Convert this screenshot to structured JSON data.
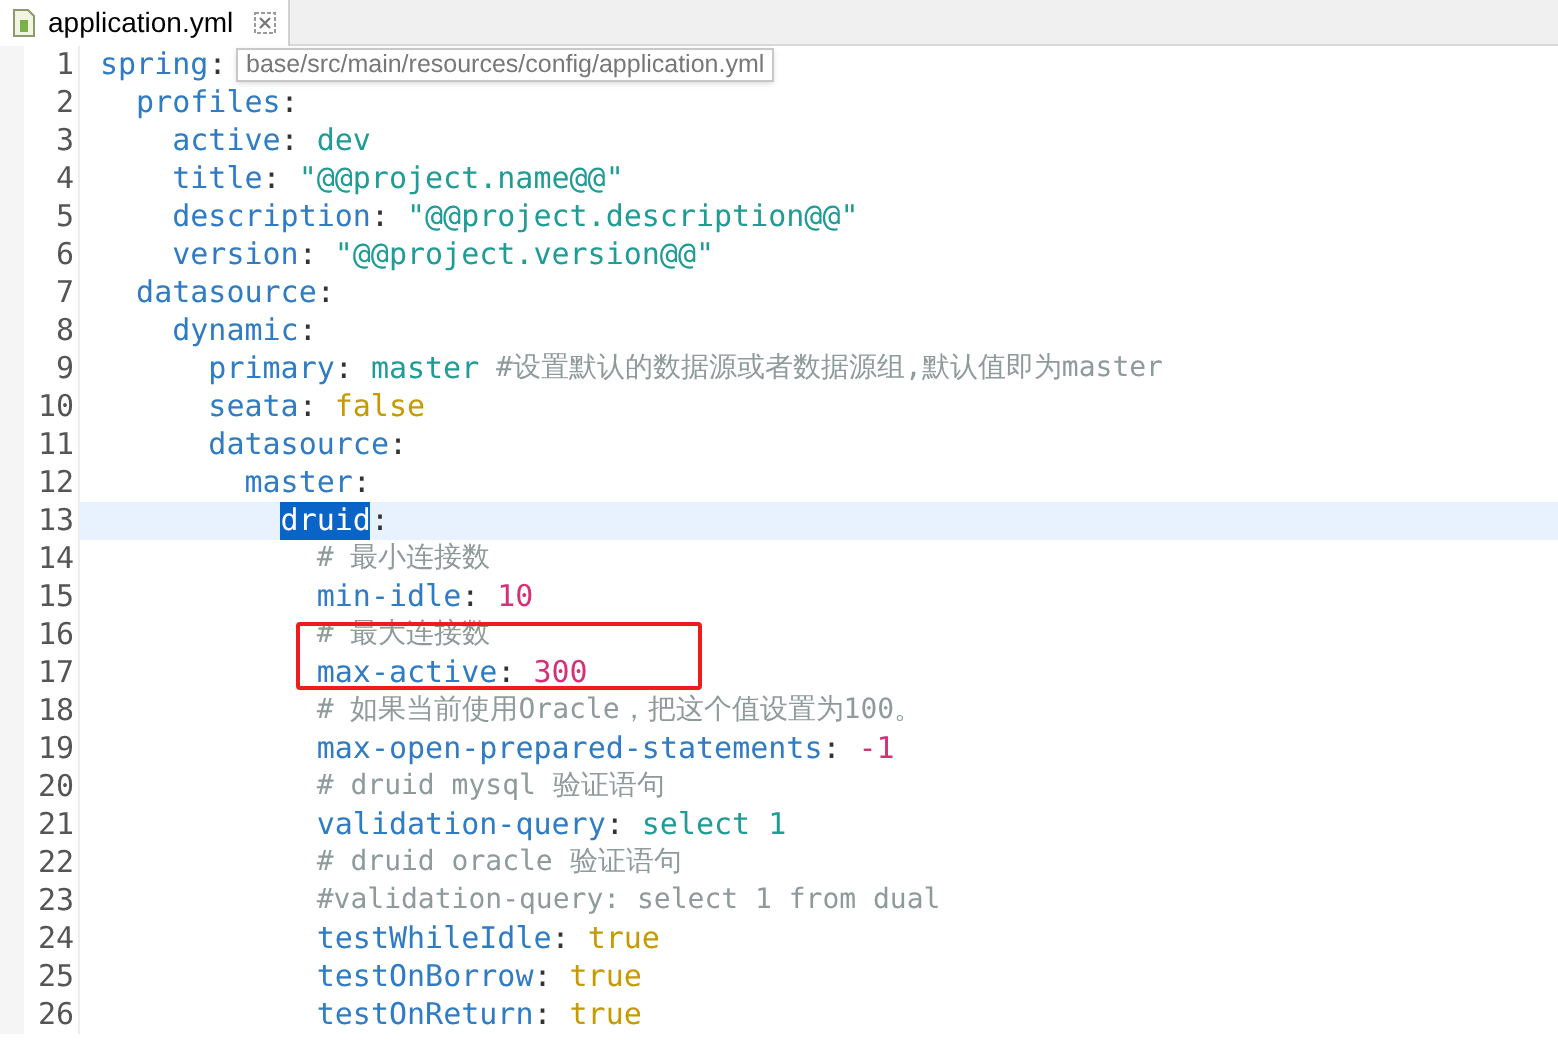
{
  "tab": {
    "label": "application.yml"
  },
  "tooltip": "base/src/main/resources/config/application.yml",
  "lines": [
    {
      "number": "1",
      "kind": "entry",
      "key": "spring",
      "separator": ":",
      "current": false,
      "boxed": false,
      "children": [
        {
          "number": "2",
          "kind": "entry",
          "key": "profiles",
          "separator": ":",
          "current": false,
          "boxed": false,
          "children": [
            {
              "number": "3",
              "kind": "entry",
              "key": "active",
              "separator": ":",
              "value": {
                "kind": "string",
                "text": "dev"
              },
              "current": false,
              "boxed": false
            },
            {
              "number": "4",
              "kind": "entry",
              "key": "title",
              "separator": ":",
              "value": {
                "kind": "string",
                "text": "\"@@project.name@@\""
              },
              "current": false,
              "boxed": false
            },
            {
              "number": "5",
              "kind": "entry",
              "key": "description",
              "separator": ":",
              "value": {
                "kind": "string",
                "text": "\"@@project.description@@\""
              },
              "current": false,
              "boxed": false
            },
            {
              "number": "6",
              "kind": "entry",
              "key": "version",
              "separator": ":",
              "value": {
                "kind": "string",
                "text": "\"@@project.version@@\""
              },
              "current": false,
              "boxed": false
            }
          ]
        },
        {
          "number": "7",
          "kind": "entry",
          "key": "datasource",
          "separator": ":",
          "current": false,
          "boxed": false,
          "children": [
            {
              "number": "8",
              "kind": "entry",
              "key": "dynamic",
              "separator": ":",
              "current": false,
              "boxed": false,
              "children": [
                {
                  "number": "9",
                  "kind": "entry",
                  "key": "primary",
                  "separator": ":",
                  "value": {
                    "kind": "string",
                    "text": "master"
                  },
                  "comment": "#设置默认的数据源或者数据源组,默认值即为master",
                  "current": false,
                  "boxed": false
                },
                {
                  "number": "10",
                  "kind": "entry",
                  "key": "seata",
                  "separator": ":",
                  "value": {
                    "kind": "boolean",
                    "text": "false"
                  },
                  "current": false,
                  "boxed": false
                },
                {
                  "number": "11",
                  "kind": "entry",
                  "key": "datasource",
                  "separator": ":",
                  "current": false,
                  "boxed": false,
                  "children": [
                    {
                      "number": "12",
                      "kind": "entry",
                      "key": "master",
                      "separator": ":",
                      "current": false,
                      "boxed": false,
                      "children": [
                        {
                          "number": "13",
                          "kind": "entry",
                          "key": "druid",
                          "separator": ":",
                          "current": true,
                          "boxed": false,
                          "children": [
                            {
                              "number": "14",
                              "kind": "comment",
                              "comment": "# 最小连接数",
                              "current": false,
                              "boxed": false
                            },
                            {
                              "number": "15",
                              "kind": "entry",
                              "key": "min-idle",
                              "separator": ":",
                              "value": {
                                "kind": "number",
                                "text": "10"
                              },
                              "current": false,
                              "boxed": false
                            },
                            {
                              "number": "16",
                              "kind": "comment",
                              "comment": "# 最大连接数",
                              "current": false,
                              "boxed": true
                            },
                            {
                              "number": "17",
                              "kind": "entry",
                              "key": "max-active",
                              "separator": ":",
                              "value": {
                                "kind": "number",
                                "text": "300"
                              },
                              "current": false,
                              "boxed": true
                            },
                            {
                              "number": "18",
                              "kind": "comment",
                              "comment": "# 如果当前使用Oracle，把这个值设置为100。",
                              "current": false,
                              "boxed": false
                            },
                            {
                              "number": "19",
                              "kind": "entry",
                              "key": "max-open-prepared-statements",
                              "separator": ":",
                              "value": {
                                "kind": "number",
                                "text": "-1"
                              },
                              "current": false,
                              "boxed": false
                            },
                            {
                              "number": "20",
                              "kind": "comment",
                              "comment": "# druid mysql 验证语句",
                              "current": false,
                              "boxed": false
                            },
                            {
                              "number": "21",
                              "kind": "entry",
                              "key": "validation-query",
                              "separator": ":",
                              "value": {
                                "kind": "string",
                                "text": "select 1"
                              },
                              "current": false,
                              "boxed": false
                            },
                            {
                              "number": "22",
                              "kind": "comment",
                              "comment": "# druid oracle 验证语句",
                              "current": false,
                              "boxed": false
                            },
                            {
                              "number": "23",
                              "kind": "comment",
                              "comment": "#validation-query: select 1 from dual",
                              "current": false,
                              "boxed": false
                            },
                            {
                              "number": "24",
                              "kind": "entry",
                              "key": "testWhileIdle",
                              "separator": ":",
                              "value": {
                                "kind": "boolean",
                                "text": "true"
                              },
                              "current": false,
                              "boxed": false
                            },
                            {
                              "number": "25",
                              "kind": "entry",
                              "key": "testOnBorrow",
                              "separator": ":",
                              "value": {
                                "kind": "boolean",
                                "text": "true"
                              },
                              "current": false,
                              "boxed": false
                            },
                            {
                              "number": "26",
                              "kind": "entry",
                              "key": "testOnReturn",
                              "separator": ":",
                              "value": {
                                "kind": "boolean",
                                "text": "true"
                              },
                              "current": false,
                              "boxed": false
                            }
                          ]
                        }
                      ]
                    }
                  ]
                }
              ]
            }
          ]
        }
      ]
    }
  ]
}
